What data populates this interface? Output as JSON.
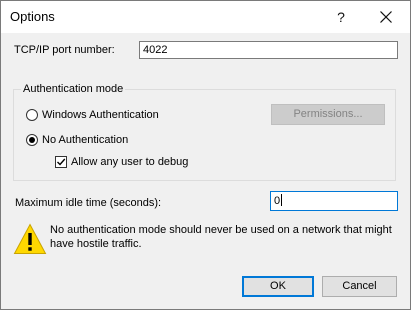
{
  "window": {
    "title": "Options",
    "help_glyph": "?"
  },
  "port": {
    "label": "TCP/IP port number:",
    "value": "4022"
  },
  "auth": {
    "group_label": "Authentication mode",
    "windows_label": "Windows Authentication",
    "windows_selected": false,
    "permissions_label": "Permissions...",
    "permissions_enabled": false,
    "none_label": "No Authentication",
    "none_selected": true,
    "allow_debug_label": "Allow any user to debug",
    "allow_debug_checked": true
  },
  "idle": {
    "label": "Maximum idle time (seconds):",
    "value": "0"
  },
  "warning": {
    "text": "No authentication mode should never be used on a network that might have hostile traffic."
  },
  "buttons": {
    "ok_label": "OK",
    "cancel_label": "Cancel"
  },
  "icons": {
    "close": "close-icon",
    "help": "help-icon",
    "warning": "warning-icon",
    "check": "checkmark-icon"
  },
  "colors": {
    "accent": "#0078d7",
    "dialog_bg": "#f0f0f0",
    "warning_yellow": "#ffd800"
  }
}
